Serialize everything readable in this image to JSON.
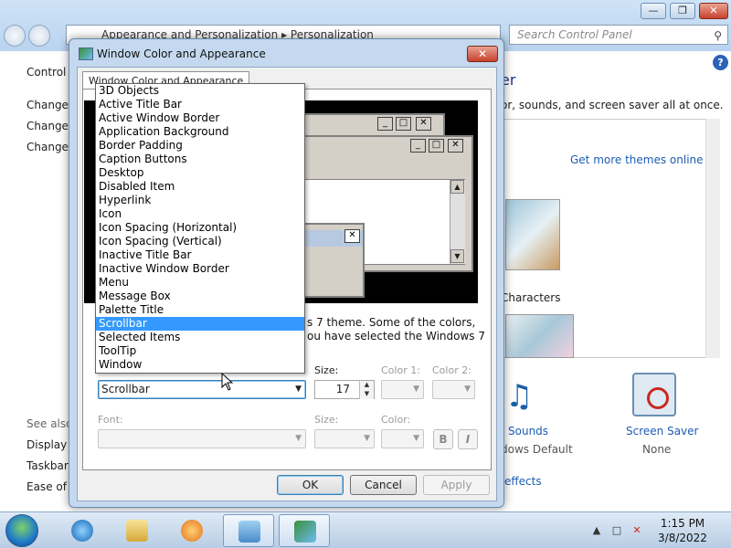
{
  "control_panel": {
    "breadcrumb": [
      "Appearance and Personalization",
      "Personalization"
    ],
    "search_placeholder": "Search Control Panel",
    "left_nav": {
      "home": "Control P",
      "links": [
        "Change",
        "Change",
        "Change y"
      ],
      "see_also": "See also",
      "see_also_links": [
        "Display",
        "Taskbar a",
        "Ease of A"
      ]
    },
    "header_fragment": "er",
    "desc_fragment": "or, sounds, and screen saver all at once.",
    "get_more_themes": "Get more themes online",
    "theme_label_fragment": "Characters",
    "bottom_items": {
      "sounds_label": "Sounds",
      "sounds_value": "dows Default",
      "screensaver_label": "Screen Saver",
      "screensaver_value": "None",
      "effects_link": "effects"
    }
  },
  "dialog": {
    "title": "Window Color and Appearance",
    "tab_label": "Window Color and Appearance",
    "preview": {
      "close_glyph": "✕",
      "min_glyph": "_",
      "max_glyph": "□"
    },
    "info_line1": "s 7 theme.  Some of the colors,",
    "info_line2": "ou have selected the Windows 7",
    "labels": {
      "size1": "Size:",
      "color1": "Color 1:",
      "color2": "Color 2:",
      "font": "Font:",
      "size2": "Size:",
      "color": "Color:"
    },
    "item_selected": "Scrollbar",
    "size_value": "17",
    "bold_btn": "B",
    "italic_btn": "I",
    "buttons": {
      "ok": "OK",
      "cancel": "Cancel",
      "apply": "Apply"
    }
  },
  "item_dropdown": {
    "options": [
      "3D Objects",
      "Active Title Bar",
      "Active Window Border",
      "Application Background",
      "Border Padding",
      "Caption Buttons",
      "Desktop",
      "Disabled Item",
      "Hyperlink",
      "Icon",
      "Icon Spacing (Horizontal)",
      "Icon Spacing (Vertical)",
      "Inactive Title Bar",
      "Inactive Window Border",
      "Menu",
      "Message Box",
      "Palette Title",
      "Scrollbar",
      "Selected Items",
      "ToolTip",
      "Window"
    ],
    "highlighted_index": 17
  },
  "taskbar": {
    "time": "1:15 PM",
    "date": "3/8/2022"
  },
  "colors": {
    "highlight": "#3399ff",
    "link": "#1c5db4",
    "dialog_frame": "#c4d9ef"
  }
}
